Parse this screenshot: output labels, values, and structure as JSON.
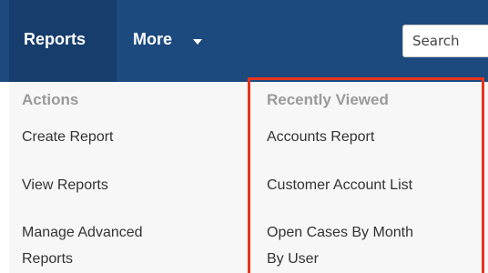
{
  "nav": {
    "reports_label": "Reports",
    "more_label": "More",
    "search_placeholder": "Search"
  },
  "menu": {
    "actions": {
      "heading": "Actions",
      "items": [
        {
          "label": "Create Report"
        },
        {
          "label": "View Reports"
        },
        {
          "label_line1": "Manage Advanced",
          "label_line2": "Reports"
        }
      ]
    },
    "recently_viewed": {
      "heading": "Recently Viewed",
      "items": [
        {
          "label": "Accounts Report"
        },
        {
          "label": "Customer Account List"
        },
        {
          "label_line1": "Open Cases By Month",
          "label_line2": "By User"
        }
      ]
    }
  },
  "colors": {
    "navbar": "#1c4a7e",
    "active_tab": "#163d6b",
    "highlight_border": "#e8331c",
    "heading_text": "#9a9a9a"
  }
}
